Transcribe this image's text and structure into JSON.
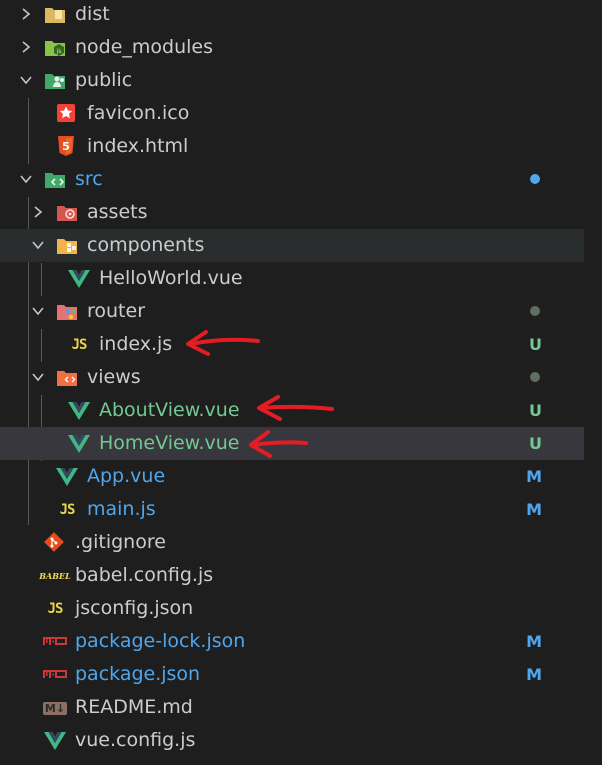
{
  "explorer": {
    "items": [
      {
        "label": "dist",
        "kind": "folder",
        "icon": "dist-folder-icon"
      },
      {
        "label": "node_modules",
        "kind": "folder",
        "icon": "node-folder-icon"
      },
      {
        "label": "public",
        "kind": "folder-open",
        "icon": "public-folder-icon"
      },
      {
        "label": "favicon.ico",
        "kind": "file",
        "icon": "favicon-icon"
      },
      {
        "label": "index.html",
        "kind": "file",
        "icon": "html5-icon"
      },
      {
        "label": "src",
        "kind": "folder-open",
        "icon": "src-folder-icon",
        "status": "dot"
      },
      {
        "label": "assets",
        "kind": "folder",
        "icon": "assets-folder-icon"
      },
      {
        "label": "components",
        "kind": "folder-open",
        "icon": "components-folder-icon"
      },
      {
        "label": "HelloWorld.vue",
        "kind": "file",
        "icon": "vue-icon"
      },
      {
        "label": "router",
        "kind": "folder-open",
        "icon": "router-folder-icon",
        "status": "dot"
      },
      {
        "label": "index.js",
        "kind": "file",
        "icon": "js-icon",
        "status": "U"
      },
      {
        "label": "views",
        "kind": "folder-open",
        "icon": "views-folder-icon",
        "status": "dot"
      },
      {
        "label": "AboutView.vue",
        "kind": "file",
        "icon": "vue-icon",
        "status": "U"
      },
      {
        "label": "HomeView.vue",
        "kind": "file",
        "icon": "vue-icon",
        "status": "U"
      },
      {
        "label": "App.vue",
        "kind": "file",
        "icon": "vue-icon",
        "status": "M"
      },
      {
        "label": "main.js",
        "kind": "file",
        "icon": "js-icon",
        "status": "M"
      },
      {
        "label": ".gitignore",
        "kind": "file",
        "icon": "git-icon"
      },
      {
        "label": "babel.config.js",
        "kind": "file",
        "icon": "babel-icon"
      },
      {
        "label": "jsconfig.json",
        "kind": "file",
        "icon": "jsconfig-icon"
      },
      {
        "label": "package-lock.json",
        "kind": "file",
        "icon": "npm-icon",
        "status": "M"
      },
      {
        "label": "package.json",
        "kind": "file",
        "icon": "npm-icon",
        "status": "M"
      },
      {
        "label": "README.md",
        "kind": "file",
        "icon": "markdown-icon"
      },
      {
        "label": "vue.config.js",
        "kind": "file",
        "icon": "vue-icon"
      }
    ],
    "badge_labels": {
      "untracked": "U",
      "modified": "M"
    },
    "js_glyph": "JS",
    "babel_glyph": "BABEL",
    "md_glyph": "M↓"
  },
  "colors": {
    "background": "#1e1e1e",
    "text": "#cccccc",
    "untracked": "#73c991",
    "modified": "#4fa6ec",
    "vue_green": "#41b883",
    "arrow_red": "#e51c23"
  }
}
